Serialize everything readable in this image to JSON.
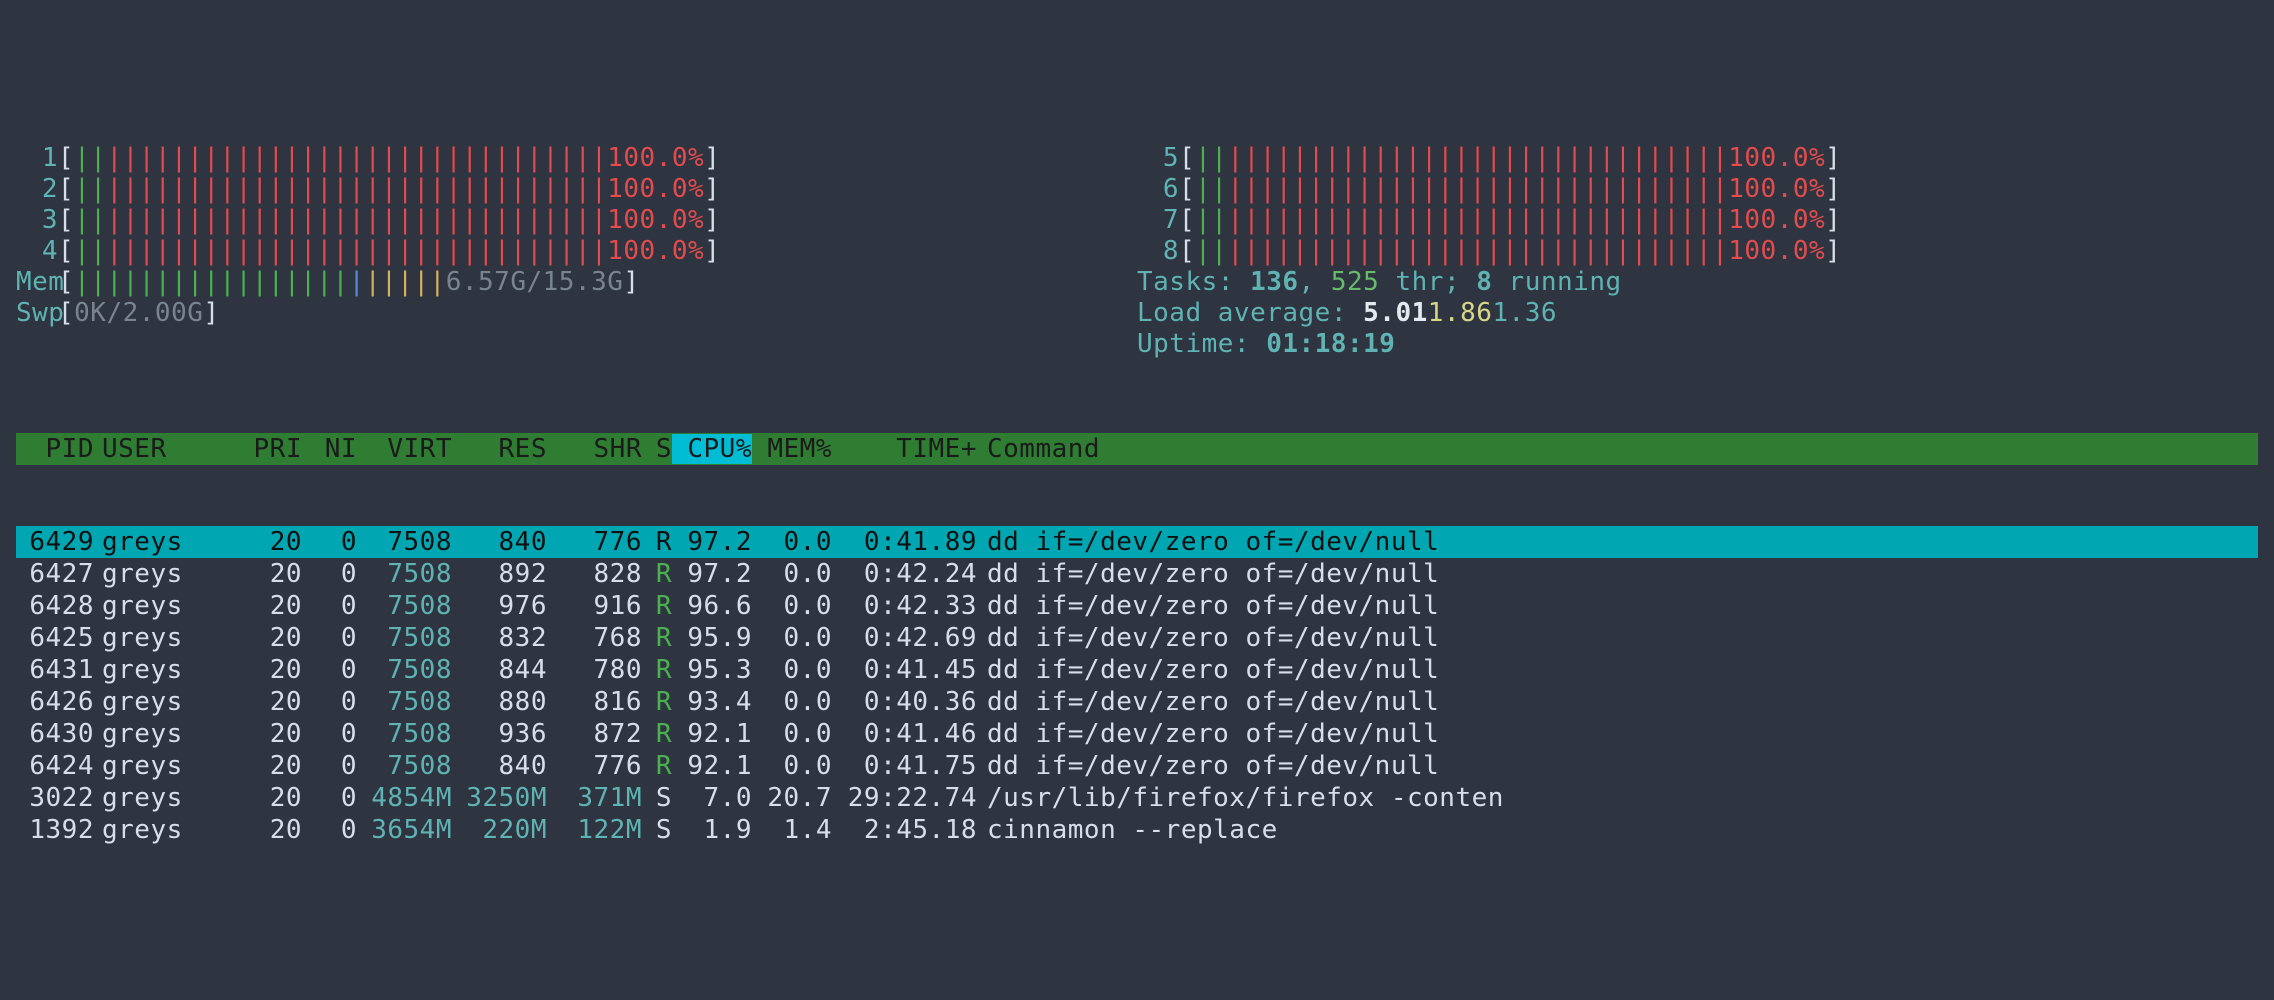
{
  "cpu_cores": [
    {
      "id": "1",
      "pct": "100.0%"
    },
    {
      "id": "2",
      "pct": "100.0%"
    },
    {
      "id": "3",
      "pct": "100.0%"
    },
    {
      "id": "4",
      "pct": "100.0%"
    },
    {
      "id": "5",
      "pct": "100.0%"
    },
    {
      "id": "6",
      "pct": "100.0%"
    },
    {
      "id": "7",
      "pct": "100.0%"
    },
    {
      "id": "8",
      "pct": "100.0%"
    }
  ],
  "mem": {
    "label": "Mem",
    "value": "6.57G/15.3G"
  },
  "swp": {
    "label": "Swp",
    "value": "0K/2.00G"
  },
  "tasks": {
    "label": "Tasks: ",
    "count": "136",
    "sep": ", ",
    "thr": "525",
    "thr_label": " thr; ",
    "running": "8",
    "running_label": " running"
  },
  "load": {
    "label": "Load average: ",
    "l1": "5.01",
    "l2": "1.86",
    "l3": "1.36"
  },
  "uptime": {
    "label": "Uptime: ",
    "value": "01:18:19"
  },
  "header": {
    "pid": "PID",
    "user": "USER",
    "pri": "PRI",
    "ni": "NI",
    "virt": "VIRT",
    "res": "RES",
    "shr": "SHR",
    "s": "S",
    "cpu": "CPU%",
    "mem": "MEM%",
    "time": "TIME+",
    "cmd": "Command"
  },
  "procs": [
    {
      "pid": "6429",
      "user": "greys",
      "pri": "20",
      "ni": "0",
      "virt": "7508",
      "res": "840",
      "shr": "776",
      "s": "R",
      "cpu": "97.2",
      "mem": "0.0",
      "time": "0:41.89",
      "cmd": "dd if=/dev/zero of=/dev/null",
      "selected": true,
      "virtcyan": false
    },
    {
      "pid": "6427",
      "user": "greys",
      "pri": "20",
      "ni": "0",
      "virt": "7508",
      "res": "892",
      "shr": "828",
      "s": "R",
      "cpu": "97.2",
      "mem": "0.0",
      "time": "0:42.24",
      "cmd": "dd if=/dev/zero of=/dev/null",
      "virtcyan": true
    },
    {
      "pid": "6428",
      "user": "greys",
      "pri": "20",
      "ni": "0",
      "virt": "7508",
      "res": "976",
      "shr": "916",
      "s": "R",
      "cpu": "96.6",
      "mem": "0.0",
      "time": "0:42.33",
      "cmd": "dd if=/dev/zero of=/dev/null",
      "virtcyan": true
    },
    {
      "pid": "6425",
      "user": "greys",
      "pri": "20",
      "ni": "0",
      "virt": "7508",
      "res": "832",
      "shr": "768",
      "s": "R",
      "cpu": "95.9",
      "mem": "0.0",
      "time": "0:42.69",
      "cmd": "dd if=/dev/zero of=/dev/null",
      "virtcyan": true
    },
    {
      "pid": "6431",
      "user": "greys",
      "pri": "20",
      "ni": "0",
      "virt": "7508",
      "res": "844",
      "shr": "780",
      "s": "R",
      "cpu": "95.3",
      "mem": "0.0",
      "time": "0:41.45",
      "cmd": "dd if=/dev/zero of=/dev/null",
      "virtcyan": true
    },
    {
      "pid": "6426",
      "user": "greys",
      "pri": "20",
      "ni": "0",
      "virt": "7508",
      "res": "880",
      "shr": "816",
      "s": "R",
      "cpu": "93.4",
      "mem": "0.0",
      "time": "0:40.36",
      "cmd": "dd if=/dev/zero of=/dev/null",
      "virtcyan": true
    },
    {
      "pid": "6430",
      "user": "greys",
      "pri": "20",
      "ni": "0",
      "virt": "7508",
      "res": "936",
      "shr": "872",
      "s": "R",
      "cpu": "92.1",
      "mem": "0.0",
      "time": "0:41.46",
      "cmd": "dd if=/dev/zero of=/dev/null",
      "virtcyan": true
    },
    {
      "pid": "6424",
      "user": "greys",
      "pri": "20",
      "ni": "0",
      "virt": "7508",
      "res": "840",
      "shr": "776",
      "s": "R",
      "cpu": "92.1",
      "mem": "0.0",
      "time": "0:41.75",
      "cmd": "dd if=/dev/zero of=/dev/null",
      "virtcyan": true
    },
    {
      "pid": "3022",
      "user": "greys",
      "pri": "20",
      "ni": "0",
      "virt": "4854M",
      "res": "3250M",
      "shr": "371M",
      "s": "S",
      "cpu": "7.0",
      "mem": "20.7",
      "time": "29:22.74",
      "cmd": "/usr/lib/firefox/firefox -conten",
      "virtcyan": true,
      "rescyan": true,
      "shrcyan": true
    },
    {
      "pid": "1392",
      "user": "greys",
      "pri": "20",
      "ni": "0",
      "virt": "3654M",
      "res": "220M",
      "shr": "122M",
      "s": "S",
      "cpu": "1.9",
      "mem": "1.4",
      "time": "2:45.18",
      "cmd": "cinnamon --replace",
      "virtcyan": true,
      "rescyan": true,
      "shrcyan": true
    }
  ]
}
